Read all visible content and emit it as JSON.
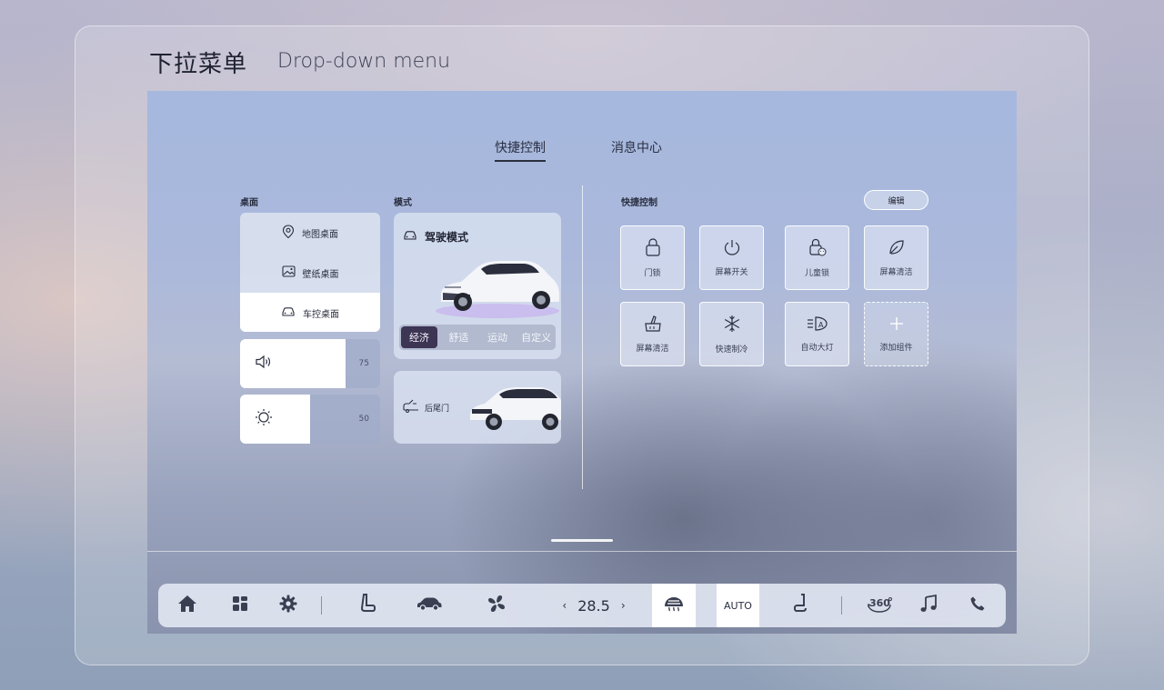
{
  "header": {
    "title_cn": "下拉菜单",
    "title_en": "Drop-down menu"
  },
  "tabs": [
    {
      "label": "快捷控制"
    },
    {
      "label": "消息中心"
    }
  ],
  "desktop": {
    "label": "桌面",
    "items": [
      {
        "label": "地图桌面",
        "icon": "map-pin-icon"
      },
      {
        "label": "壁纸桌面",
        "icon": "image-icon"
      },
      {
        "label": "车控桌面",
        "icon": "car-icon"
      }
    ],
    "active_index": 2
  },
  "volume": {
    "value": 75,
    "display": "75",
    "icon": "speaker-icon"
  },
  "brightness": {
    "value": 50,
    "display": "50",
    "icon": "sun-icon"
  },
  "mode": {
    "label": "模式",
    "title": "驾驶模式",
    "options": [
      "经济",
      "舒适",
      "运动",
      "自定义"
    ],
    "selected": "经济"
  },
  "trunk": {
    "label": "后尾门",
    "icon": "trunk-icon"
  },
  "quick_control": {
    "label": "快捷控制",
    "edit_label": "编辑",
    "tiles": [
      {
        "label": "门锁",
        "icon": "lock-icon"
      },
      {
        "label": "屏幕开关",
        "icon": "power-icon"
      },
      {
        "label": "儿童锁",
        "icon": "child-lock-icon"
      },
      {
        "label": "屏幕清洁",
        "icon": "leaf-icon"
      },
      {
        "label": "屏幕清洁",
        "icon": "cleaning-icon"
      },
      {
        "label": "快速制冷",
        "icon": "snowflake-icon"
      },
      {
        "label": "自动大灯",
        "icon": "auto-headlight-icon"
      },
      {
        "label": "添加组件",
        "icon": "plus-icon"
      }
    ]
  },
  "dock": {
    "temperature": "28.5",
    "auto_label": "AUTO",
    "icons": [
      "home-icon",
      "apps-icon",
      "gear-icon",
      "seat-icon",
      "car-icon",
      "fan-icon",
      "rear-defrost-icon",
      "seat-heat-icon",
      "camera-360-icon",
      "music-icon",
      "phone-icon"
    ],
    "camera_label": "360"
  }
}
